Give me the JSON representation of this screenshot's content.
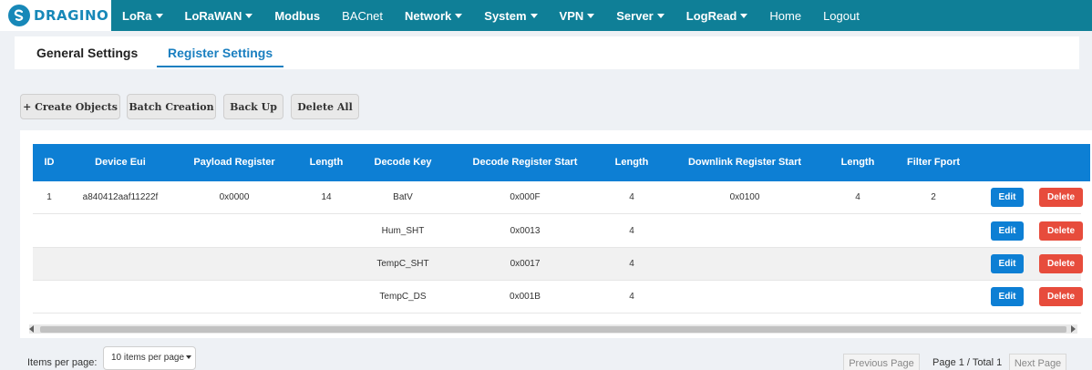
{
  "brand": {
    "logo_text": "DRAGINO"
  },
  "nav": {
    "items": [
      {
        "label": "LoRa",
        "caret": true
      },
      {
        "label": "LoRaWAN",
        "caret": true
      },
      {
        "label": "Modbus",
        "caret": false
      },
      {
        "label": "BACnet",
        "caret": false
      },
      {
        "label": "Network",
        "caret": true
      },
      {
        "label": "System",
        "caret": true
      },
      {
        "label": "VPN",
        "caret": true
      },
      {
        "label": "Server",
        "caret": true
      },
      {
        "label": "LogRead",
        "caret": true
      },
      {
        "label": "Home",
        "caret": false
      },
      {
        "label": "Logout",
        "caret": false
      }
    ]
  },
  "tabs": {
    "general": "General Settings",
    "register": "Register Settings"
  },
  "actions": {
    "create": "+ Create Objects",
    "batch": "Batch Creation",
    "backup": "Back Up",
    "delete_all": "Delete All"
  },
  "table": {
    "headers": [
      "ID",
      "Device Eui",
      "Payload Register",
      "Length",
      "Decode Key",
      "Decode Register Start",
      "Length",
      "Downlink Register Start",
      "Length",
      "Filter Fport"
    ],
    "rows": [
      [
        "1",
        "a840412aaf11222f",
        "0x0000",
        "14",
        "BatV",
        "0x000F",
        "4",
        "0x0100",
        "4",
        "2"
      ],
      [
        "",
        "",
        "",
        "",
        "Hum_SHT",
        "0x0013",
        "4",
        "",
        "",
        ""
      ],
      [
        "",
        "",
        "",
        "",
        "TempC_SHT",
        "0x0017",
        "4",
        "",
        "",
        ""
      ],
      [
        "",
        "",
        "",
        "",
        "TempC_DS",
        "0x001B",
        "4",
        "",
        "",
        ""
      ]
    ],
    "edit_label": "Edit",
    "delete_label": "Delete"
  },
  "pagination": {
    "items_per_page_label": "Items per page:",
    "items_per_page_value": "10 items per page",
    "prev": "Previous Page",
    "info": "Page 1 / Total 1",
    "next": "Next Page"
  },
  "colors": {
    "navbar": "#0f7f97",
    "brand": "#1788b8",
    "table_header": "#0d7fd4",
    "edit_button": "#0d7fd4",
    "delete_button": "#e74c3c",
    "active_tab": "#1a7fc0"
  }
}
